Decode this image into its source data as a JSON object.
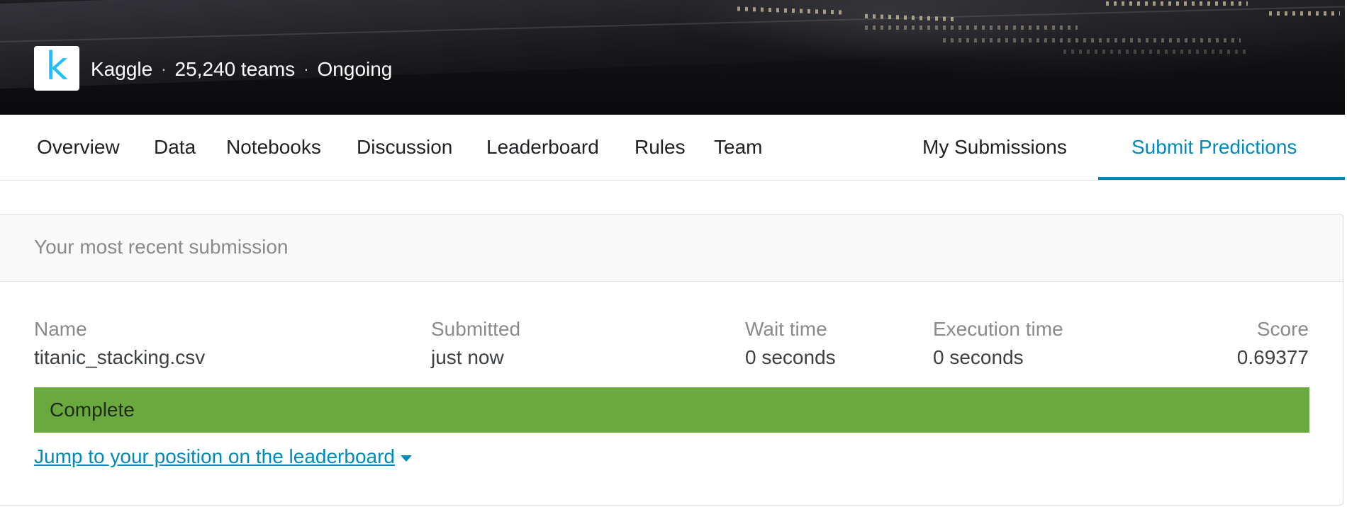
{
  "header": {
    "logo_letter": "k",
    "host": "Kaggle",
    "separator": "·",
    "teams": "25,240 teams",
    "status": "Ongoing"
  },
  "tabs": {
    "left": [
      {
        "label": "Overview"
      },
      {
        "label": "Data"
      },
      {
        "label": "Notebooks"
      },
      {
        "label": "Discussion"
      },
      {
        "label": "Leaderboard"
      },
      {
        "label": "Rules"
      },
      {
        "label": "Team"
      }
    ],
    "my_submissions": "My Submissions",
    "submit_predictions": "Submit Predictions",
    "active": "Submit Predictions"
  },
  "submission": {
    "section_title": "Your most recent submission",
    "columns": {
      "name": "Name",
      "submitted": "Submitted",
      "wait_time": "Wait time",
      "execution_time": "Execution time",
      "score": "Score"
    },
    "values": {
      "name": "titanic_stacking.csv",
      "submitted": "just now",
      "wait_time": "0 seconds",
      "execution_time": "0 seconds",
      "score": "0.69377"
    },
    "status": "Complete",
    "jump_link": "Jump to your position on the leaderboard"
  },
  "colors": {
    "accent": "#008abc",
    "status_complete": "#6aa93e",
    "logo_blue": "#20beff"
  }
}
